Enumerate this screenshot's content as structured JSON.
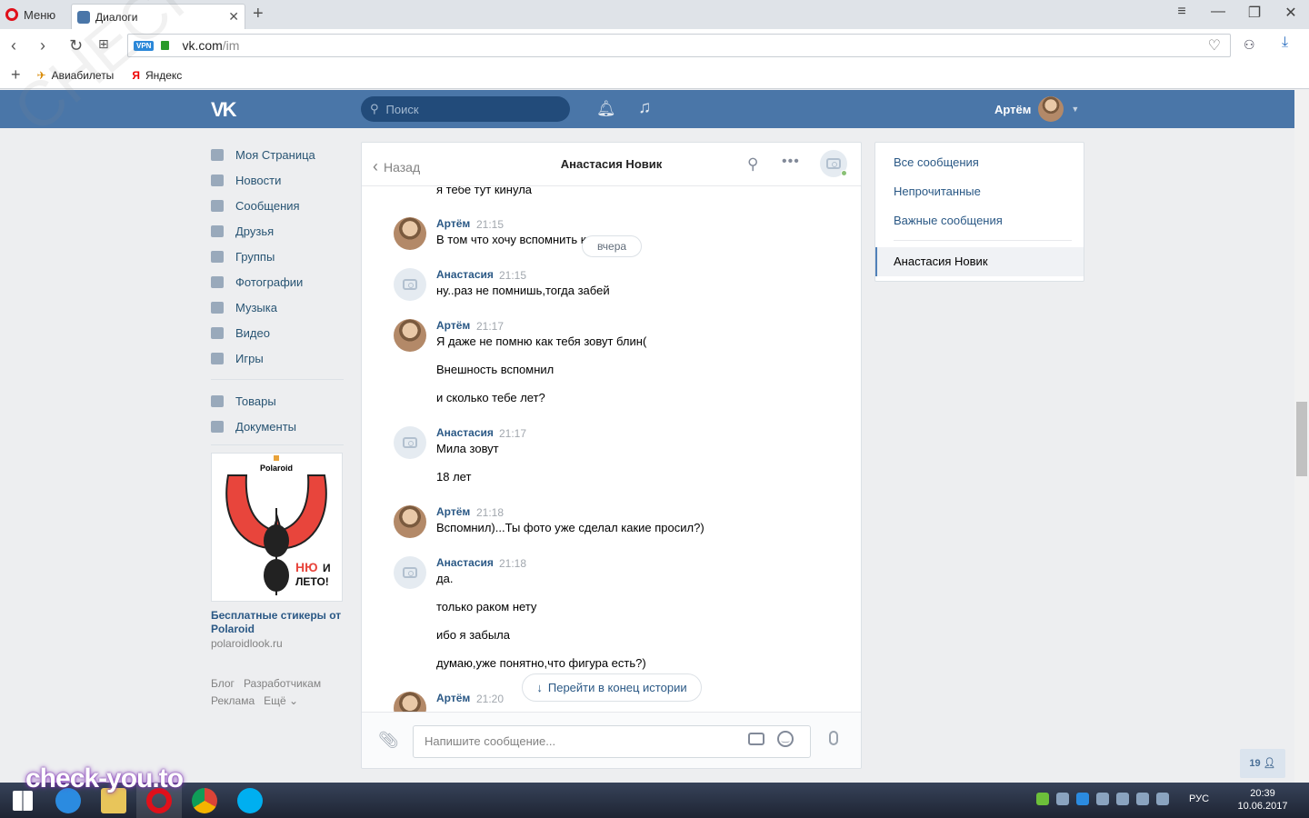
{
  "browser": {
    "menu_label": "Меню",
    "tab_title": "Диалоги",
    "url_host": "vk.com",
    "url_path": "/im",
    "vpn_badge": "VPN",
    "bookmarks": [
      {
        "label": "Авиабилеты",
        "icon": "plane-icon"
      },
      {
        "label": "Яндекс",
        "icon": "yandex-icon"
      }
    ]
  },
  "header": {
    "logo": "vk",
    "search_placeholder": "Поиск",
    "user_name": "Артём"
  },
  "sidebar": {
    "items": [
      {
        "label": "Моя Страница",
        "icon": "home-icon"
      },
      {
        "label": "Новости",
        "icon": "news-icon"
      },
      {
        "label": "Сообщения",
        "icon": "messages-icon"
      },
      {
        "label": "Друзья",
        "icon": "friends-icon"
      },
      {
        "label": "Группы",
        "icon": "groups-icon"
      },
      {
        "label": "Фотографии",
        "icon": "camera-icon"
      },
      {
        "label": "Музыка",
        "icon": "music-icon"
      },
      {
        "label": "Видео",
        "icon": "video-icon"
      },
      {
        "label": "Игры",
        "icon": "games-icon"
      }
    ],
    "items2": [
      {
        "label": "Товары",
        "icon": "bag-icon"
      },
      {
        "label": "Документы",
        "icon": "document-icon"
      }
    ],
    "ad": {
      "brand": "Polaroid",
      "slogan_1": "НЮ",
      "slogan_and": "И",
      "slogan_2": "ЛЕТО!",
      "title": "Бесплатные стикеры от Polaroid",
      "site": "polaroidlook.ru"
    },
    "footer": [
      "Блог",
      "Разработчикам",
      "Реклама",
      "Ещё ⌄"
    ]
  },
  "chat": {
    "back_label": "Назад",
    "title": "Анастасия Новик",
    "cut_text": "я тебе тут кинула",
    "date_pill": "вчера",
    "goto_end": "Перейти в конец истории",
    "input_placeholder": "Напишите сообщение...",
    "messages": [
      {
        "author": "Артём",
        "time": "21:15",
        "avatar": "photo",
        "lines": [
          "В том что хочу вспомнить кто ты"
        ]
      },
      {
        "author": "Анастасия",
        "time": "21:15",
        "avatar": "camera",
        "lines": [
          "ну..раз не помнишь,тогда забей"
        ]
      },
      {
        "author": "Артём",
        "time": "21:17",
        "avatar": "photo",
        "lines": [
          "Я даже не помню как тебя зовут блин(",
          "Внешность вспомнил",
          "и сколько тебе лет?"
        ]
      },
      {
        "author": "Анастасия",
        "time": "21:17",
        "avatar": "camera",
        "lines": [
          "Мила зовут",
          "18 лет"
        ]
      },
      {
        "author": "Артём",
        "time": "21:18",
        "avatar": "photo",
        "lines": [
          "Вспомнил)...Ты фото уже сделал какие просил?)"
        ]
      },
      {
        "author": "Анастасия",
        "time": "21:18",
        "avatar": "camera",
        "lines": [
          "да.",
          "только раком нету",
          "ибо я забыла",
          "думаю,уже понятно,что фигура есть?)"
        ]
      },
      {
        "author": "Артём",
        "time": "21:20",
        "avatar": "photo",
        "lines": []
      }
    ]
  },
  "right_panel": {
    "items": [
      "Все сообщения",
      "Непрочитанные",
      "Важные сообщения"
    ],
    "active": "Анастасия Новик"
  },
  "counter": "19",
  "taskbar": {
    "lang": "РУС",
    "time": "20:39",
    "date": "10.06.2017"
  },
  "watermark": "check-you.to",
  "watermark_diag": "CHECK-YOU.ME"
}
